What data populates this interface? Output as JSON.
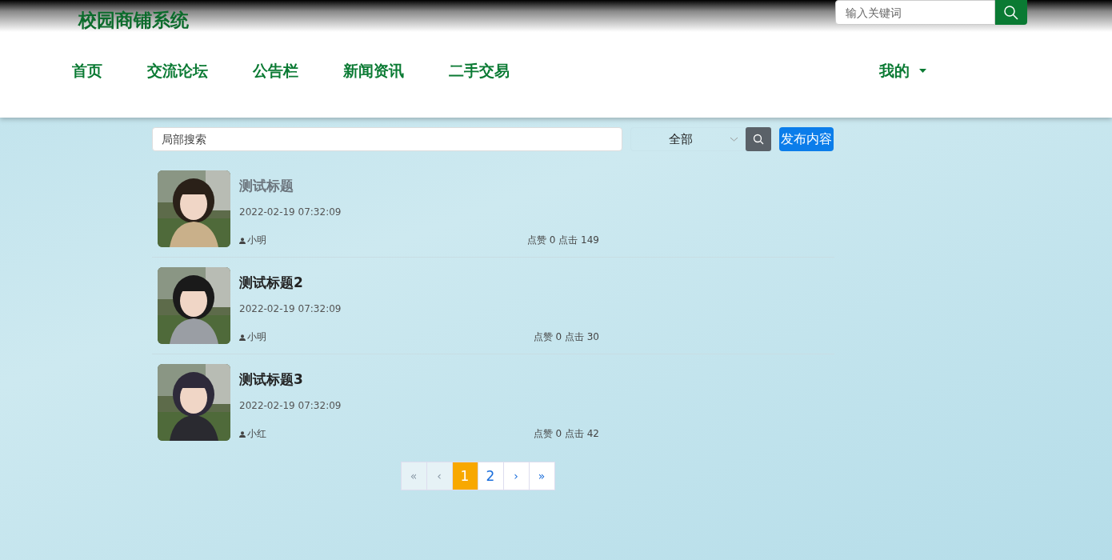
{
  "site_title": "校园商铺系统",
  "header_search": {
    "placeholder": "输入关键词"
  },
  "nav": [
    {
      "label": "首页"
    },
    {
      "label": "交流论坛"
    },
    {
      "label": "公告栏"
    },
    {
      "label": "新闻资讯"
    },
    {
      "label": "二手交易"
    }
  ],
  "user_menu": {
    "label": "我的"
  },
  "filter": {
    "placeholder": "局部搜索",
    "category": "全部",
    "publish_button": "发布内容"
  },
  "posts": [
    {
      "title": "测试标题",
      "highlighted": true,
      "time": "2022-02-19 07:32:09",
      "author": "小明",
      "stats": "点赞 0 点击 149"
    },
    {
      "title": "测试标题2",
      "highlighted": false,
      "time": "2022-02-19 07:32:09",
      "author": "小明",
      "stats": "点赞 0 点击 30"
    },
    {
      "title": "测试标题3",
      "highlighted": false,
      "time": "2022-02-19 07:32:09",
      "author": "小红",
      "stats": "点赞 0 点击 42"
    }
  ],
  "pagination": [
    {
      "label": "«",
      "disabled": true,
      "selected": false
    },
    {
      "label": "‹",
      "disabled": true,
      "selected": false
    },
    {
      "label": "1",
      "disabled": false,
      "selected": true
    },
    {
      "label": "2",
      "disabled": false,
      "selected": false
    },
    {
      "label": "›",
      "disabled": false,
      "selected": false
    },
    {
      "label": "»",
      "disabled": false,
      "selected": false
    }
  ]
}
